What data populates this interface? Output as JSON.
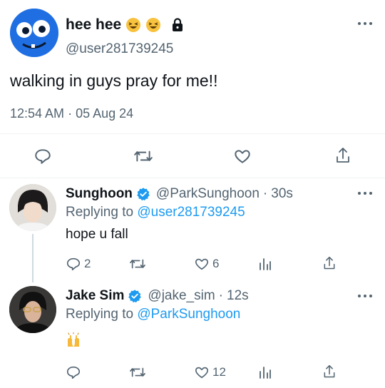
{
  "main_tweet": {
    "display_name": "hee hee",
    "handle": "@user281739245",
    "text": "walking in guys pray for me!!",
    "time": "12:54 AM",
    "separator": "·",
    "date": "05 Aug 24"
  },
  "replies": [
    {
      "display_name": "Sunghoon",
      "handle": "@ParkSunghoon",
      "separator": "·",
      "age": "30s",
      "replying_prefix": "Replying to",
      "replying_to": "@user281739245",
      "text": "hope u fall",
      "reply_count": "2",
      "like_count": "6"
    },
    {
      "display_name": "Jake Sim",
      "handle": "@jake_sim",
      "separator": "·",
      "age": "12s",
      "replying_prefix": "Replying to",
      "replying_to": "@ParkSunghoon",
      "text": "🙌",
      "like_count": "12"
    }
  ],
  "colors": {
    "link": "#1d9bf0",
    "muted": "#536471",
    "verified": "#1d9bf0",
    "divider": "#eff3f4",
    "avatar_main": "#1e6fe0"
  },
  "icons": [
    "more-icon",
    "reply-icon",
    "retweet-icon",
    "like-icon",
    "share-icon",
    "views-icon",
    "verified-badge-icon",
    "lock-icon",
    "laughing-emoji-icon",
    "raised-hands-emoji-icon"
  ]
}
